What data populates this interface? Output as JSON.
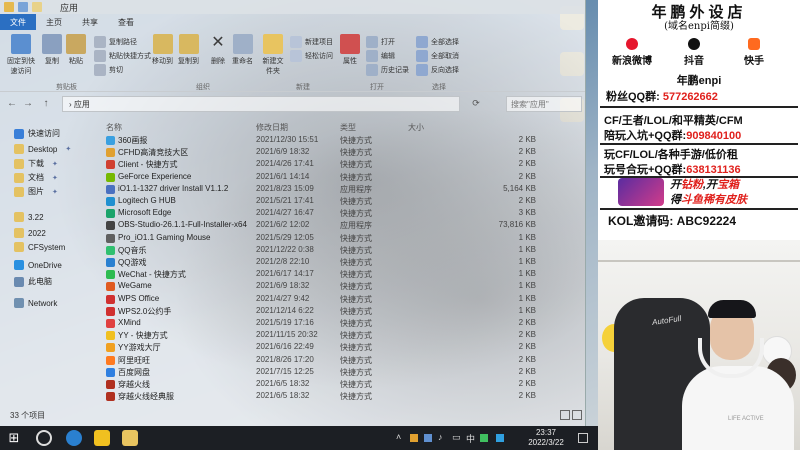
{
  "explorer": {
    "window_title": "应用",
    "tabs": [
      "文件",
      "主页",
      "共享",
      "查看"
    ],
    "ribbon": {
      "pin_quick_access": "固定到快速访问",
      "copy": "复制",
      "paste": "粘贴",
      "copy_path": "复制路径",
      "paste_shortcut": "粘贴快捷方式",
      "cut": "剪切",
      "move_to": "移动到",
      "copy_to": "复制到",
      "delete": "删除",
      "rename": "重命名",
      "new_folder": "新建文件夹",
      "new_item": "新建项目",
      "easy_access": "轻松访问",
      "properties": "属性",
      "open": "打开",
      "edit": "编辑",
      "history": "历史记录",
      "select_all": "全部选择",
      "select_none": "全部取消",
      "invert_selection": "反向选择",
      "groups": {
        "clipboard": "剪贴板",
        "organize": "组织",
        "new": "新建",
        "open": "打开",
        "select": "选择"
      }
    },
    "address": {
      "back": "←",
      "forward": "→",
      "up": "↑",
      "path": "› 应用",
      "search_placeholder": "搜索\"应用\""
    },
    "nav": [
      {
        "label": "快速访问",
        "pinned": false
      },
      {
        "label": "Desktop",
        "pinned": true
      },
      {
        "label": "下载",
        "pinned": true
      },
      {
        "label": "文档",
        "pinned": true
      },
      {
        "label": "图片",
        "pinned": true
      },
      {
        "label": "3.22",
        "pinned": false
      },
      {
        "label": "2022",
        "pinned": false
      },
      {
        "label": "CFSystem",
        "pinned": false
      },
      {
        "label": "OneDrive",
        "pinned": false
      },
      {
        "label": "此电脑",
        "pinned": false
      },
      {
        "label": "Network",
        "pinned": false
      }
    ],
    "columns": {
      "name": "名称",
      "date": "修改日期",
      "type": "类型",
      "size": "大小"
    },
    "files": [
      {
        "name": "360画报",
        "date": "2021/12/30 15:51",
        "type": "快捷方式",
        "size": "2 KB",
        "color": "#3aa0e0"
      },
      {
        "name": "CFHD高清竞技大区",
        "date": "2021/6/9 18:32",
        "type": "快捷方式",
        "size": "2 KB",
        "color": "#e0a030"
      },
      {
        "name": "Client - 快捷方式",
        "date": "2021/4/26 17:41",
        "type": "快捷方式",
        "size": "2 KB",
        "color": "#d04030"
      },
      {
        "name": "GeForce Experience",
        "date": "2021/6/1 14:14",
        "type": "快捷方式",
        "size": "2 KB",
        "color": "#76b900"
      },
      {
        "name": "iO1.1-1327 driver Install V1.1.2",
        "date": "2021/8/23 15:09",
        "type": "应用程序",
        "size": "5,164 KB",
        "color": "#4a70c0"
      },
      {
        "name": "Logitech G HUB",
        "date": "2021/5/21 17:41",
        "type": "快捷方式",
        "size": "2 KB",
        "color": "#2090d0"
      },
      {
        "name": "Microsoft Edge",
        "date": "2021/4/27 16:47",
        "type": "快捷方式",
        "size": "3 KB",
        "color": "#1aa36a"
      },
      {
        "name": "OBS-Studio-26.1.1-Full-Installer-x64",
        "date": "2021/6/2 12:02",
        "type": "应用程序",
        "size": "73,816 KB",
        "color": "#444444"
      },
      {
        "name": "Pro_iO1.1 Gaming Mouse",
        "date": "2021/5/29 12:05",
        "type": "快捷方式",
        "size": "1 KB",
        "color": "#606060"
      },
      {
        "name": "QQ音乐",
        "date": "2021/12/22 0:38",
        "type": "快捷方式",
        "size": "1 KB",
        "color": "#30c070"
      },
      {
        "name": "QQ游戏",
        "date": "2021/2/8 22:10",
        "type": "快捷方式",
        "size": "1 KB",
        "color": "#2a80d0"
      },
      {
        "name": "WeChat - 快捷方式",
        "date": "2021/6/17 14:17",
        "type": "快捷方式",
        "size": "1 KB",
        "color": "#2dbb50"
      },
      {
        "name": "WeGame",
        "date": "2021/6/9 18:32",
        "type": "快捷方式",
        "size": "1 KB",
        "color": "#e05a20"
      },
      {
        "name": "WPS Office",
        "date": "2021/4/27 9:42",
        "type": "快捷方式",
        "size": "1 KB",
        "color": "#d03030"
      },
      {
        "name": "WPS2.0公约手",
        "date": "2021/12/14 6:22",
        "type": "快捷方式",
        "size": "1 KB",
        "color": "#d03030"
      },
      {
        "name": "XMind",
        "date": "2021/5/19 17:16",
        "type": "快捷方式",
        "size": "2 KB",
        "color": "#e04040"
      },
      {
        "name": "YY - 快捷方式",
        "date": "2021/11/15 20:32",
        "type": "快捷方式",
        "size": "2 KB",
        "color": "#f0c020"
      },
      {
        "name": "YY游戏大厅",
        "date": "2021/6/16 22:49",
        "type": "快捷方式",
        "size": "2 KB",
        "color": "#f0a020"
      },
      {
        "name": "阿里旺旺",
        "date": "2021/8/26 17:20",
        "type": "快捷方式",
        "size": "2 KB",
        "color": "#ff7a20"
      },
      {
        "name": "百度网盘",
        "date": "2021/7/15 12:25",
        "type": "快捷方式",
        "size": "2 KB",
        "color": "#3080e0"
      },
      {
        "name": "穿越火线",
        "date": "2021/6/5 18:32",
        "type": "快捷方式",
        "size": "2 KB",
        "color": "#b03020"
      },
      {
        "name": "穿越火线经典服",
        "date": "2021/6/5 18:32",
        "type": "快捷方式",
        "size": "2 KB",
        "color": "#b03020"
      }
    ],
    "status": "33 个项目"
  },
  "taskbar": {
    "time": "23:37",
    "date": "2022/3/22",
    "ime": "中"
  },
  "panel": {
    "title": "年鹏外设店",
    "subtitle": "(域名enpi简缀)",
    "socials": [
      {
        "label": "新浪微博",
        "color": "#e6162d"
      },
      {
        "label": "抖音",
        "color": "#111111"
      },
      {
        "label": "快手",
        "color": "#ff6a1f"
      }
    ],
    "account": "年鹏enpi",
    "fans_qq_label": "粉丝QQ群:",
    "fans_qq": "577262662",
    "line1": "CF/王者/LOL/和平精英/CFM",
    "line2_label": "陪玩入坑+QQ群:",
    "line2_value": "909840100",
    "line3": "玩CF/LOL/各种手游/低价租",
    "line4_label": "玩号合玩+QQ群:",
    "line4_value": "638131136",
    "banner_line1_a": "开",
    "banner_line1_b": "钻粉",
    "banner_line1_c": ",开",
    "banner_line1_d": "宝箱",
    "banner_line2_a": "得",
    "banner_line2_b": "斗鱼稀有皮肤",
    "kol": "KOL邀请码: ABC92224",
    "chair_brand": "AutoFull",
    "shirt_text": "LIFE ACTIVE"
  }
}
